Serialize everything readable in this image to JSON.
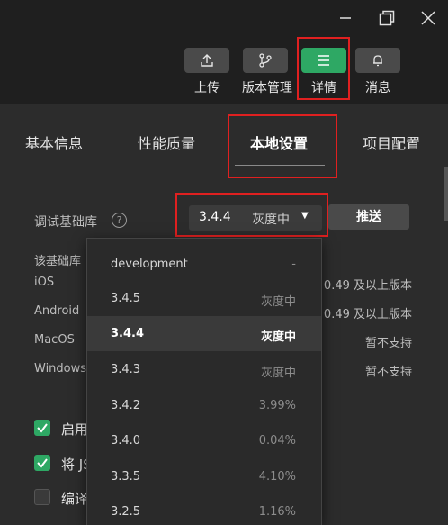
{
  "window": {
    "controls": [
      "minimize-icon",
      "restore-icon",
      "close-icon"
    ]
  },
  "toolbar": {
    "upload_label": "上传",
    "version_label": "版本管理",
    "details_label": "详情",
    "messages_label": "消息"
  },
  "tabs": [
    "基本信息",
    "性能质量",
    "本地设置",
    "项目配置"
  ],
  "active_tab": "本地设置",
  "settings": {
    "debug_lib_label": "调试基础库",
    "help_icon": "?",
    "selected_version": "3.4.4",
    "selected_status": "灰度中",
    "push_label": "推送",
    "info_header": "该基础库",
    "platforms": [
      {
        "name": "iOS",
        "value": "0.49 及以上版本"
      },
      {
        "name": "Android",
        "value": "0.49 及以上版本"
      },
      {
        "name": "MacOS",
        "value": "暂不支持"
      },
      {
        "name": "Windows",
        "value": "暂不支持"
      }
    ],
    "checkboxes": [
      {
        "label": "启用",
        "checked": true
      },
      {
        "label": "将 JS",
        "checked": true
      },
      {
        "label": "编译",
        "checked": false
      }
    ]
  },
  "dropdown": {
    "options": [
      {
        "version": "development",
        "status": "-"
      },
      {
        "version": "3.4.5",
        "status": "灰度中"
      },
      {
        "version": "3.4.4",
        "status": "灰度中",
        "selected": true
      },
      {
        "version": "3.4.3",
        "status": "灰度中"
      },
      {
        "version": "3.4.2",
        "status": "3.99%"
      },
      {
        "version": "3.4.0",
        "status": "0.04%"
      },
      {
        "version": "3.3.5",
        "status": "4.10%"
      },
      {
        "version": "3.2.5",
        "status": "1.16%"
      }
    ]
  },
  "colors": {
    "accent": "#2ea864",
    "highlight_border": "#e02020",
    "background": "#2c2c2c"
  }
}
